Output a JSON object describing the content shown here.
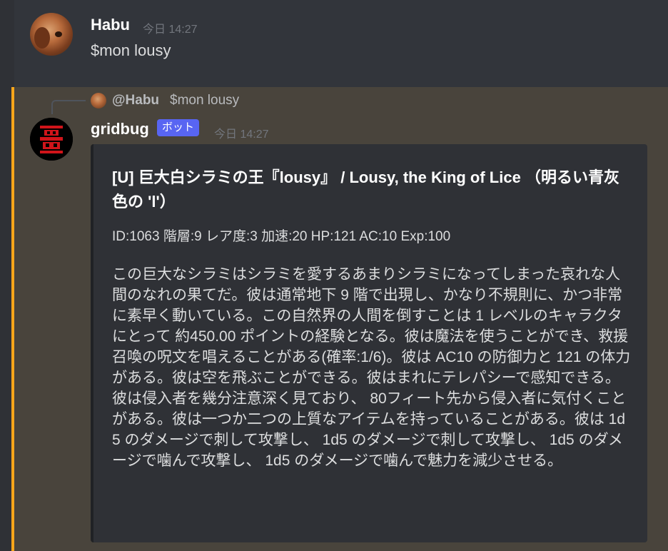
{
  "message1": {
    "username": "Habu",
    "timestamp": "今日 14:27",
    "content": "$mon lousy"
  },
  "message2": {
    "reply": {
      "mention": "@Habu",
      "text": "$mon lousy"
    },
    "username": "gridbug",
    "bot_tag": "ボット",
    "timestamp": "今日 14:27",
    "embed": {
      "title": "[U] 巨大白シラミの王『lousy』 / Lousy, the King of Lice （明るい青灰色の 'l'）",
      "stats": "ID:1063 階層:9 レア度:3 加速:20 HP:121 AC:10 Exp:100",
      "description": "この巨大なシラミはシラミを愛するあまりシラミになってしまった哀れな人間のなれの果てだ。彼は通常地下 9 階で出現し、かなり不規則に、かつ非常に素早く動いている。この自然界の人間を倒すことは 1 レベルのキャラクタにとって 約450.00 ポイントの経験となる。彼は魔法を使うことができ、救援召喚の呪文を唱えることがある(確率:1/6)。彼は AC10 の防御力と 121 の体力がある。彼は空を飛ぶことができる。彼はまれにテレパシーで感知できる。彼は侵入者を幾分注意深く見ており、 80フィート先から侵入者に気付くことがある。彼は一つか二つの上質なアイテムを持っていることがある。彼は 1d5 のダメージで刺して攻撃し、 1d5 のダメージで刺して攻撃し、 1d5 のダメージで噛んで攻撃し、 1d5 のダメージで噛んで魅力を減少させる。"
    }
  },
  "colors": {
    "background": "#36393f",
    "mention_highlight": "#49443c",
    "mention_bar": "#faa61a",
    "embed_background": "#2f3136",
    "bot_tag": "#5865f2"
  }
}
